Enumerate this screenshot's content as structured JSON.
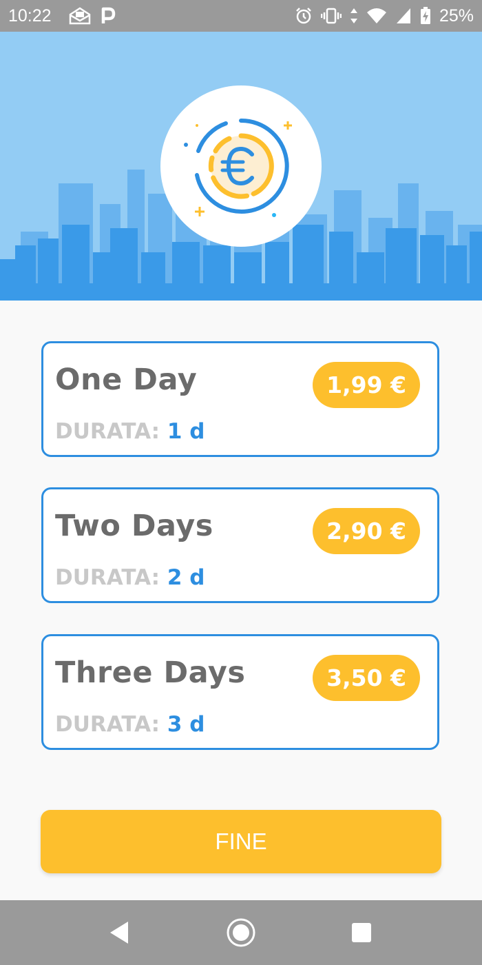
{
  "status_bar": {
    "time": "10:22",
    "battery": "25%",
    "left_icons": [
      "mail-icon",
      "parking-icon"
    ],
    "right_icons": [
      "alarm-icon",
      "vibrate-icon",
      "data-arrows-icon",
      "wifi-icon",
      "signal-icon",
      "battery-charging-icon"
    ]
  },
  "header": {
    "logo_icon": "euro-coin-icon"
  },
  "plans": [
    {
      "name": "One Day",
      "price": "1,99 €",
      "duration_label": "DURATA:",
      "duration_value": "1 d"
    },
    {
      "name": "Two Days",
      "price": "2,90 €",
      "duration_label": "DURATA:",
      "duration_value": "2 d"
    },
    {
      "name": "Three Days",
      "price": "3,50 €",
      "duration_label": "DURATA:",
      "duration_value": "3 d"
    }
  ],
  "actions": {
    "done_label": "FINE"
  },
  "nav": {
    "icons": [
      "back-icon",
      "home-icon",
      "recents-icon"
    ]
  },
  "colors": {
    "accent_blue": "#2d8ee0",
    "accent_yellow": "#fdbf2d",
    "sky": "#93ccf4"
  }
}
